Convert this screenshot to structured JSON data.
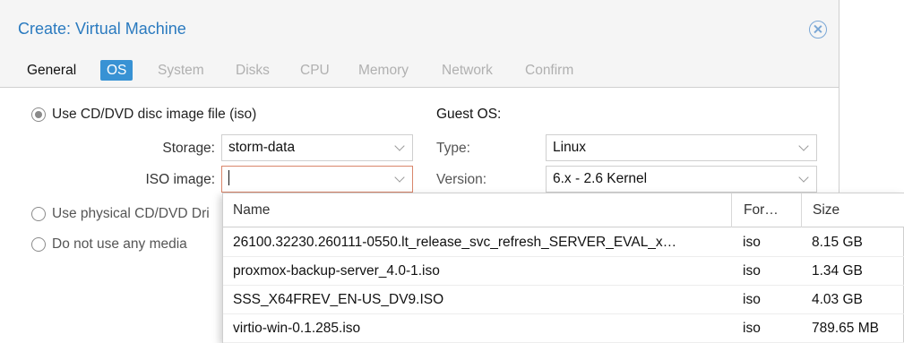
{
  "dialog": {
    "title": "Create: Virtual Machine"
  },
  "tabs": [
    {
      "label": "General",
      "state": "enabled"
    },
    {
      "label": "OS",
      "state": "active"
    },
    {
      "label": "System",
      "state": "disabled"
    },
    {
      "label": "Disks",
      "state": "disabled"
    },
    {
      "label": "CPU",
      "state": "disabled"
    },
    {
      "label": "Memory",
      "state": "disabled"
    },
    {
      "label": "Network",
      "state": "disabled"
    },
    {
      "label": "Confirm",
      "state": "disabled"
    }
  ],
  "media": {
    "option_iso": "Use CD/DVD disc image file (iso)",
    "option_physical": "Use physical CD/DVD Dri",
    "option_none": "Do not use any media",
    "storage_label": "Storage:",
    "storage_value": "storm-data",
    "iso_label": "ISO image:",
    "iso_value": ""
  },
  "guest_os": {
    "section_title": "Guest OS:",
    "type_label": "Type:",
    "type_value": "Linux",
    "version_label": "Version:",
    "version_value": "6.x - 2.6 Kernel"
  },
  "iso_dropdown": {
    "headers": {
      "name": "Name",
      "format": "For…",
      "size": "Size"
    },
    "rows": [
      {
        "name": "26100.32230.260111-0550.lt_release_svc_refresh_SERVER_EVAL_x…",
        "format": "iso",
        "size": "8.15 GB"
      },
      {
        "name": "proxmox-backup-server_4.0-1.iso",
        "format": "iso",
        "size": "1.34 GB"
      },
      {
        "name": "SSS_X64FREV_EN-US_DV9.ISO",
        "format": "iso",
        "size": "4.03 GB"
      },
      {
        "name": "virtio-win-0.1.285.iso",
        "format": "iso",
        "size": "789.65 MB"
      }
    ]
  },
  "colors": {
    "accent": "#3892d4",
    "title": "#2a7abf",
    "focus_border": "#d9866b"
  },
  "icons": {
    "close": "close-circle-icon",
    "chevron": "chevron-down-icon"
  }
}
